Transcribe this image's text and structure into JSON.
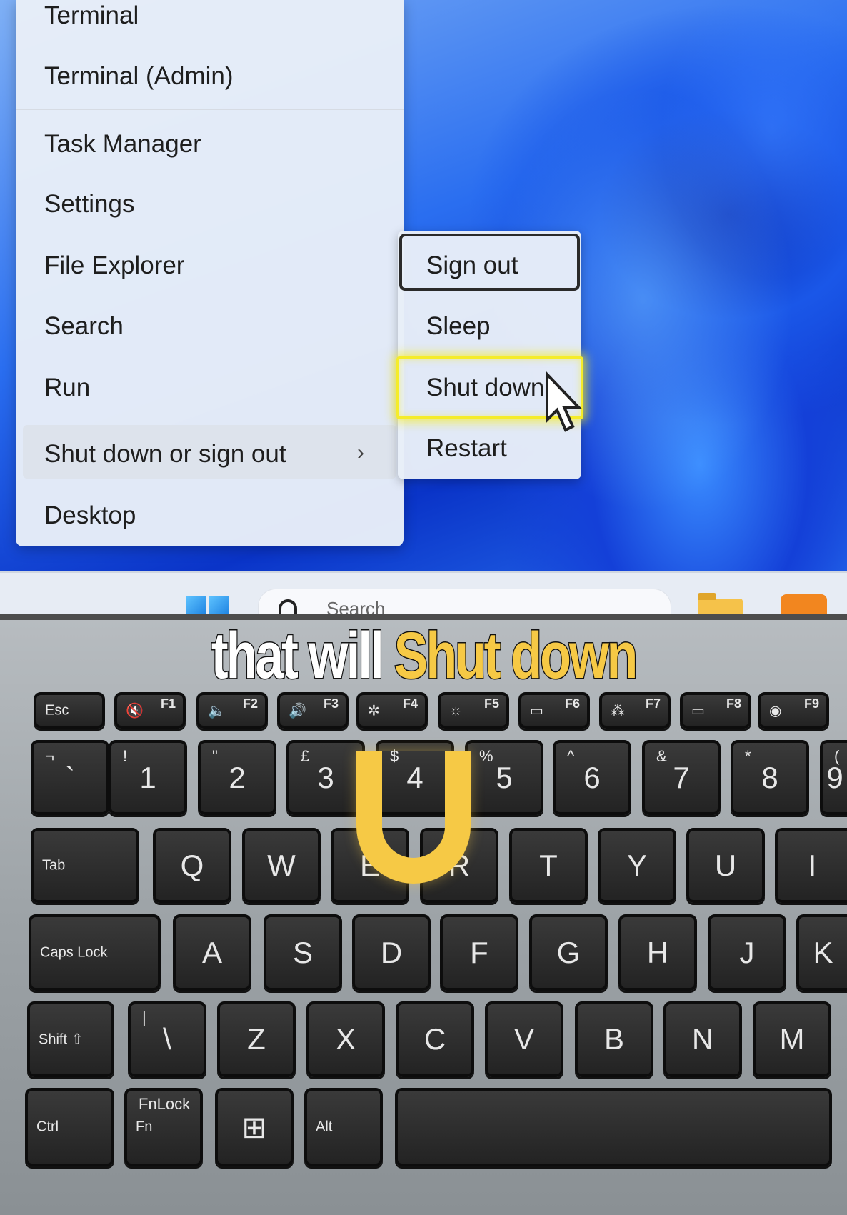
{
  "context_menu": {
    "items": [
      {
        "label": "Terminal"
      },
      {
        "label": "Terminal (Admin)"
      },
      {
        "label": "Task Manager"
      },
      {
        "label": "Settings"
      },
      {
        "label": "File Explorer"
      },
      {
        "label": "Search"
      },
      {
        "label": "Run"
      },
      {
        "label": "Shut down or sign out",
        "chevron": "›"
      },
      {
        "label": "Desktop"
      }
    ]
  },
  "submenu": {
    "items": [
      {
        "label": "Sign out"
      },
      {
        "label": "Sleep"
      },
      {
        "label": "Shut down"
      },
      {
        "label": "Restart"
      }
    ],
    "highlight_color": "#f5ec2a"
  },
  "taskbar": {
    "search_placeholder": "Search"
  },
  "caption": {
    "white": "that will",
    "yellow": "Shut down",
    "big_letter": "U",
    "accent": "#f6c945"
  },
  "keyboard": {
    "rows": [
      [
        {
          "m": "Esc"
        },
        {
          "m": "🔇",
          "f": "F1"
        },
        {
          "m": "🔈",
          "f": "F2"
        },
        {
          "m": "🔊",
          "f": "F3"
        },
        {
          "m": "✲",
          "f": "F4"
        },
        {
          "m": "☼",
          "f": "F5"
        },
        {
          "m": "▭",
          "f": "F6"
        },
        {
          "m": "⁂",
          "f": "F7"
        },
        {
          "m": "▭",
          "f": "F8"
        },
        {
          "m": "◉",
          "f": "F9"
        }
      ],
      [
        {
          "m": "`",
          "s": "¬"
        },
        {
          "m": "1",
          "s": "!"
        },
        {
          "m": "2",
          "s": "\""
        },
        {
          "m": "3",
          "s": "£"
        },
        {
          "m": "4",
          "s": "$"
        },
        {
          "m": "5",
          "s": "%"
        },
        {
          "m": "6",
          "s": "^"
        },
        {
          "m": "7",
          "s": "&"
        },
        {
          "m": "8",
          "s": "*"
        },
        {
          "m": "9",
          "s": "("
        }
      ],
      [
        {
          "m": "Tab"
        },
        {
          "m": "Q"
        },
        {
          "m": "W"
        },
        {
          "m": "E"
        },
        {
          "m": "R"
        },
        {
          "m": "T"
        },
        {
          "m": "Y"
        },
        {
          "m": "U"
        },
        {
          "m": "I"
        }
      ],
      [
        {
          "m": "Caps Lock"
        },
        {
          "m": "A"
        },
        {
          "m": "S"
        },
        {
          "m": "D"
        },
        {
          "m": "F"
        },
        {
          "m": "G"
        },
        {
          "m": "H"
        },
        {
          "m": "J"
        },
        {
          "m": "K"
        }
      ],
      [
        {
          "m": "Shift ⇧"
        },
        {
          "m": "\\",
          "s": "|"
        },
        {
          "m": "Z"
        },
        {
          "m": "X"
        },
        {
          "m": "C"
        },
        {
          "m": "V"
        },
        {
          "m": "B"
        },
        {
          "m": "N"
        },
        {
          "m": "M"
        }
      ],
      [
        {
          "m": "Ctrl"
        },
        {
          "m": "Fn",
          "s": "FnLock"
        },
        {
          "m": "⊞"
        },
        {
          "m": "Alt"
        },
        {
          "m": ""
        }
      ]
    ]
  }
}
